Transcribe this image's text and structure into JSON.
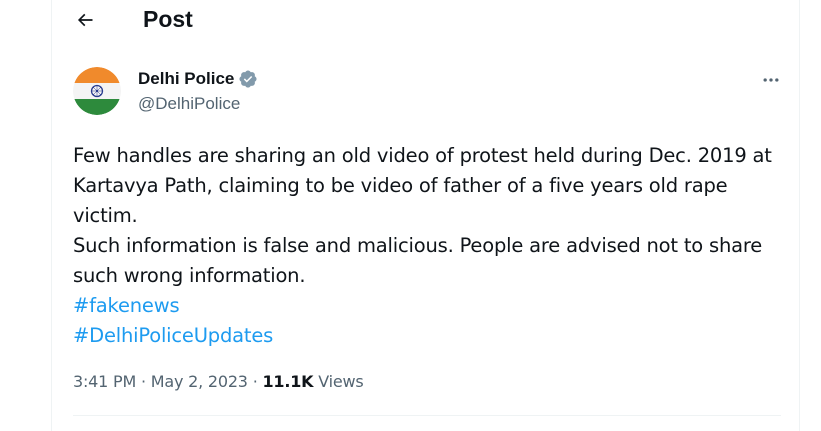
{
  "header": {
    "title": "Post",
    "back_icon": "arrow-left-icon"
  },
  "author": {
    "name": "Delhi Police",
    "handle": "@DelhiPolice",
    "verified_icon": "verified-badge-icon",
    "avatar_icon": "indian-flag-avatar"
  },
  "tweet": {
    "lines": [
      "Few handles are sharing an old video of protest held during Dec. 2019 at",
      "Kartavya Path, claiming to be video of father of a five years old rape",
      "victim.",
      "Such information is false and malicious. People are advised not to share",
      "such wrong information."
    ],
    "hashtags": [
      "#fakenews",
      "#DelhiPoliceUpdates"
    ],
    "time": "3:41 PM",
    "separator": "·",
    "date": "May 2, 2023",
    "views_count": "11.1K",
    "views_label": "Views"
  },
  "colors": {
    "link": "#1d9bf0",
    "secondary_text": "#536471",
    "primary_text": "#0f1419",
    "verified": "#829aab"
  }
}
